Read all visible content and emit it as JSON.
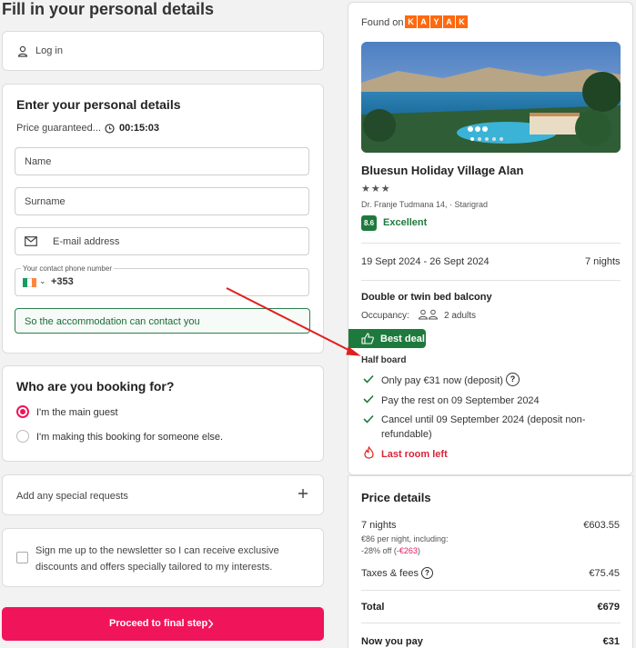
{
  "page": {
    "title": "Fill in your personal details"
  },
  "login": {
    "label": "Log in"
  },
  "personal": {
    "title": "Enter your personal details",
    "price_guaranteed": "Price guaranteed...",
    "timer": "00:15:03",
    "name_placeholder": "Name",
    "surname_placeholder": "Surname",
    "email_placeholder": "E-mail address",
    "phone_label": "Your contact phone number",
    "phone_code": "+353",
    "phone_note": "So the accommodation can contact you"
  },
  "booking_for": {
    "title": "Who are you booking for?",
    "option_main": "I'm the main guest",
    "option_other": "I'm making this booking for someone else."
  },
  "special_requests": {
    "label": "Add any special requests"
  },
  "newsletter": {
    "text": "Sign me up to the newsletter so I can receive exclusive discounts and offers specially tailored to my interests."
  },
  "proceed": {
    "label": "Proceed to final step"
  },
  "summary": {
    "found_on": "Found on",
    "kayak_letters": [
      "K",
      "A",
      "Y",
      "A",
      "K"
    ],
    "hotel_name": "Bluesun Holiday Village Alan",
    "stars": "★★★",
    "address": "Dr. Franje Tudmana 14, · Starigrad",
    "rating": "8.6",
    "rating_text": "Excellent",
    "dates": "19 Sept 2024 - 26 Sept 2024",
    "nights": "7 nights",
    "room": "Double or twin bed balcony",
    "occupancy_label": "Occupancy:",
    "occupancy_value": "2 adults",
    "best_deal": "Best deal",
    "board": "Half board",
    "perk_1": "Only pay €31 now (deposit)",
    "perk_2": "Pay the rest on 09 September 2024",
    "perk_3a": "Cancel until 09 September 2024 (deposit non-",
    "perk_3b": "refundable)",
    "last_room": "Last room left"
  },
  "price": {
    "title": "Price details",
    "nights_label": "7 nights",
    "nights_value": "€603.55",
    "per_night": "€86 per night, including:",
    "discount_pct": "-28% off (",
    "discount_amount": "-€263",
    "discount_close": ")",
    "taxes_label": "Taxes & fees",
    "taxes_value": "€75.45",
    "total_label": "Total",
    "total_value": "€679",
    "now_label": "Now you pay",
    "now_value": "€31"
  },
  "colors": {
    "brand": "#f0145a",
    "kayak": "#ff690f",
    "green": "#1e7a3c",
    "red": "#e02020"
  }
}
